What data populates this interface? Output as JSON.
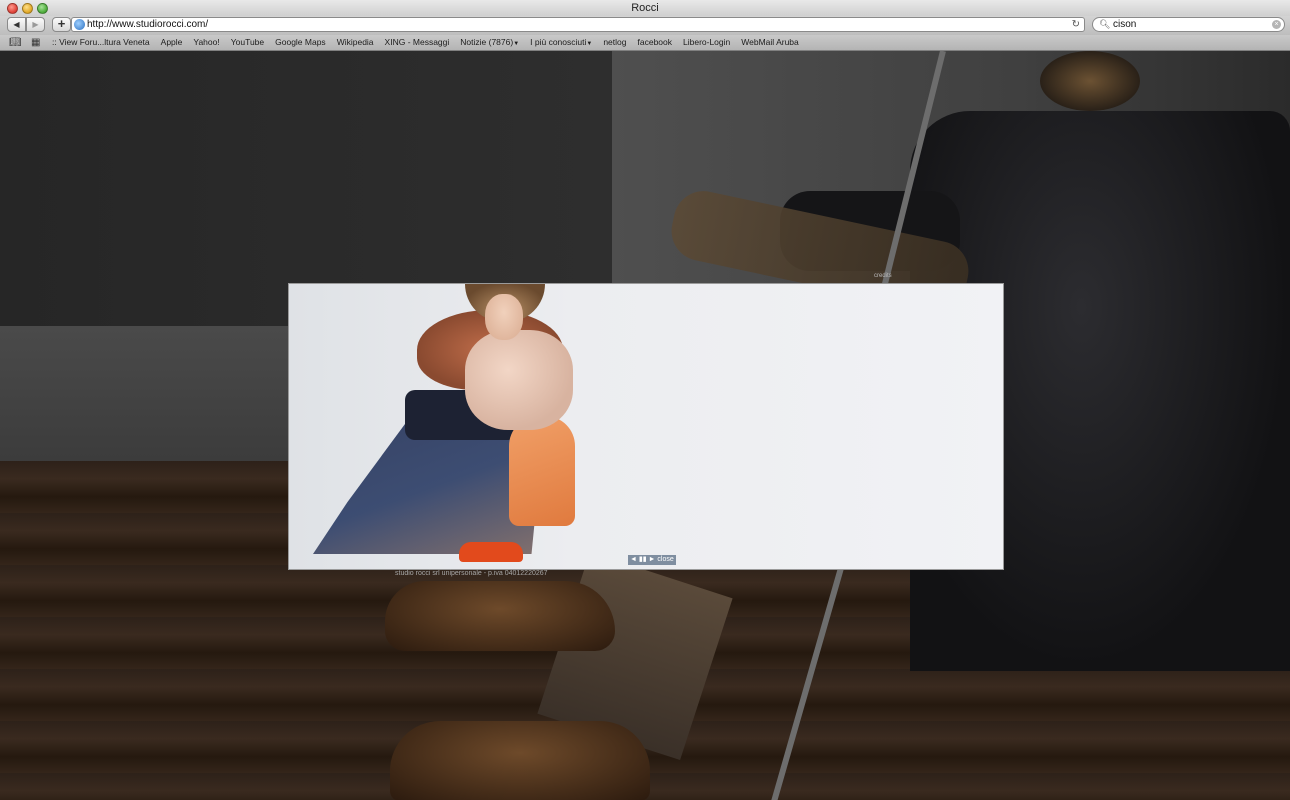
{
  "window": {
    "title": "Rocci"
  },
  "toolbar": {
    "back_icon": "back-arrow-icon",
    "forward_icon": "forward-arrow-icon",
    "add_label": "+",
    "url": "http://www.studiorocci.com/",
    "search_value": "cison"
  },
  "bookmarks": {
    "items": [
      {
        "label": ":: View Foru...ltura Veneta"
      },
      {
        "label": "Apple"
      },
      {
        "label": "Yahoo!"
      },
      {
        "label": "YouTube"
      },
      {
        "label": "Google Maps"
      },
      {
        "label": "Wikipedia"
      },
      {
        "label": "XING - Messaggi"
      },
      {
        "label": "Notizie (7876)",
        "menu": true
      },
      {
        "label": "I più conosciuti",
        "menu": true
      },
      {
        "label": "netlog"
      },
      {
        "label": "facebook"
      },
      {
        "label": "Libero-Login"
      },
      {
        "label": "WebMail Aruba"
      }
    ]
  },
  "page": {
    "credits_label": "credits",
    "slideshow_controls": "◄ ▮▮ ► close",
    "footer": "studio rocci srl unipersonale - p.iva 04012220267"
  }
}
